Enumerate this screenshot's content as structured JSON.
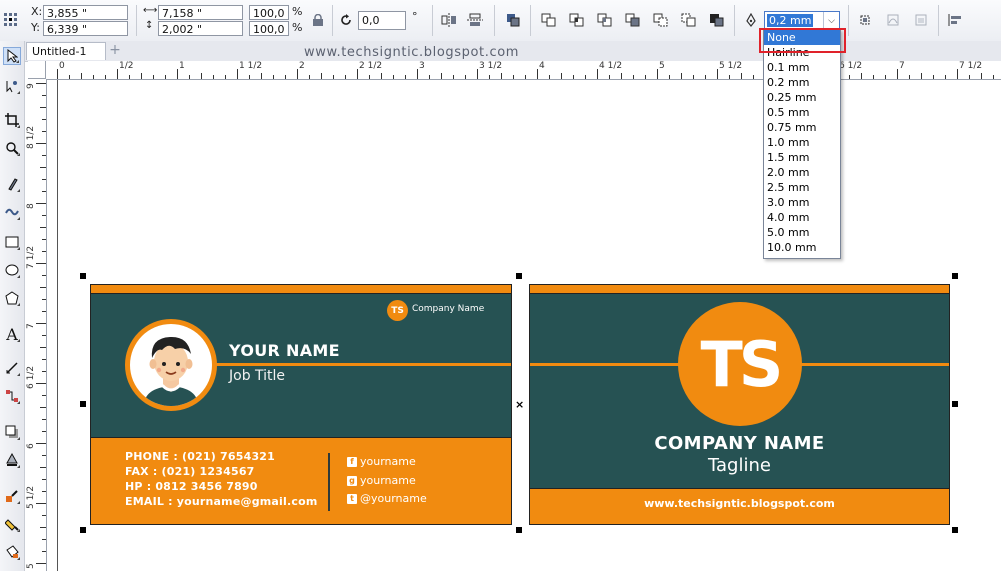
{
  "property_bar": {
    "x_label": "X:",
    "y_label": "Y:",
    "x_value": "3,855 \"",
    "y_value": "6,339 \"",
    "width_value": "7,158 \"",
    "height_value": "2,002 \"",
    "scale_x": "100,0",
    "scale_y": "100,0",
    "percent": "%",
    "rotation_value": "0,0",
    "degree": "°",
    "outline_width": "0,2 mm"
  },
  "outline_dropdown": {
    "options": [
      "None",
      "Hairline",
      "0.1 mm",
      "0.2 mm",
      "0.25 mm",
      "0.5 mm",
      "0.75 mm",
      "1.0 mm",
      "1.5 mm",
      "2.0 mm",
      "2.5 mm",
      "3.0 mm",
      "4.0 mm",
      "5.0 mm",
      "10.0 mm"
    ],
    "selected": "None"
  },
  "document": {
    "tab_title": "Untitled-1",
    "add_tab": "+",
    "watermark": "www.techsigntic.blogspot.com"
  },
  "ruler": {
    "horizontal": [
      "0",
      "1/2",
      "1",
      "1 1/2",
      "2",
      "2 1/2",
      "3",
      "3 1/2",
      "4",
      "4 1/2",
      "5",
      "5 1/2",
      "6",
      "6 1/2",
      "7",
      "7 1/2"
    ],
    "vertical": [
      "9",
      "8 1/2",
      "8",
      "7 1/2",
      "7",
      "6 1/2",
      "6",
      "5 1/2",
      "5"
    ]
  },
  "front_card": {
    "company_logo": "TS",
    "company_name": "Company Name",
    "name": "YOUR NAME",
    "job_title": "Job Title",
    "phone": "PHONE : (021) 7654321",
    "fax": "FAX : (021) 1234567",
    "hp": "HP : 0812 3456 7890",
    "email": "EMAIL : yourname@gmail.com",
    "social": [
      {
        "icon": "facebook-icon",
        "glyph": "f",
        "text": "yourname"
      },
      {
        "icon": "google-plus-icon",
        "glyph": "g",
        "text": "yourname"
      },
      {
        "icon": "twitter-icon",
        "glyph": "t",
        "text": "@yourname"
      }
    ]
  },
  "back_card": {
    "logo": "TS",
    "company_name": "COMPANY NAME",
    "tagline": "Tagline",
    "url": "www.techsigntic.blogspot.com"
  },
  "colors": {
    "card_teal": "#265253",
    "card_orange": "#f18b10",
    "selection_blue": "#3178d6",
    "callout_red": "#e0222a"
  }
}
